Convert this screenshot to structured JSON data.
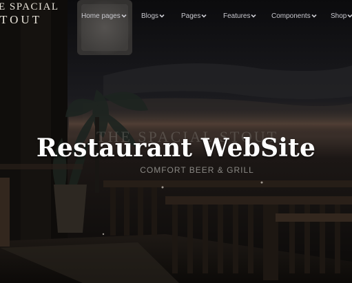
{
  "brand": {
    "line1": "E SPACIAL",
    "line2": "TOUT"
  },
  "nav": [
    {
      "label": "Home pages",
      "name": "nav-home-pages"
    },
    {
      "label": "Blogs",
      "name": "nav-blogs"
    },
    {
      "label": "Pages",
      "name": "nav-pages"
    },
    {
      "label": "Features",
      "name": "nav-features"
    },
    {
      "label": "Components",
      "name": "nav-components"
    },
    {
      "label": "Shop",
      "name": "nav-shop"
    }
  ],
  "hero": {
    "headline": "Restaurant WebSite",
    "sign_title": "THE SPACIAL STOUT",
    "sign_subtitle": "COMFORT BEER & GRILL"
  },
  "icons": {
    "dropdown": "chevron-down-icon"
  },
  "colors": {
    "nav_text": "#c9c9cf",
    "headline": "#ffffff",
    "background": "#0d0d0f"
  }
}
